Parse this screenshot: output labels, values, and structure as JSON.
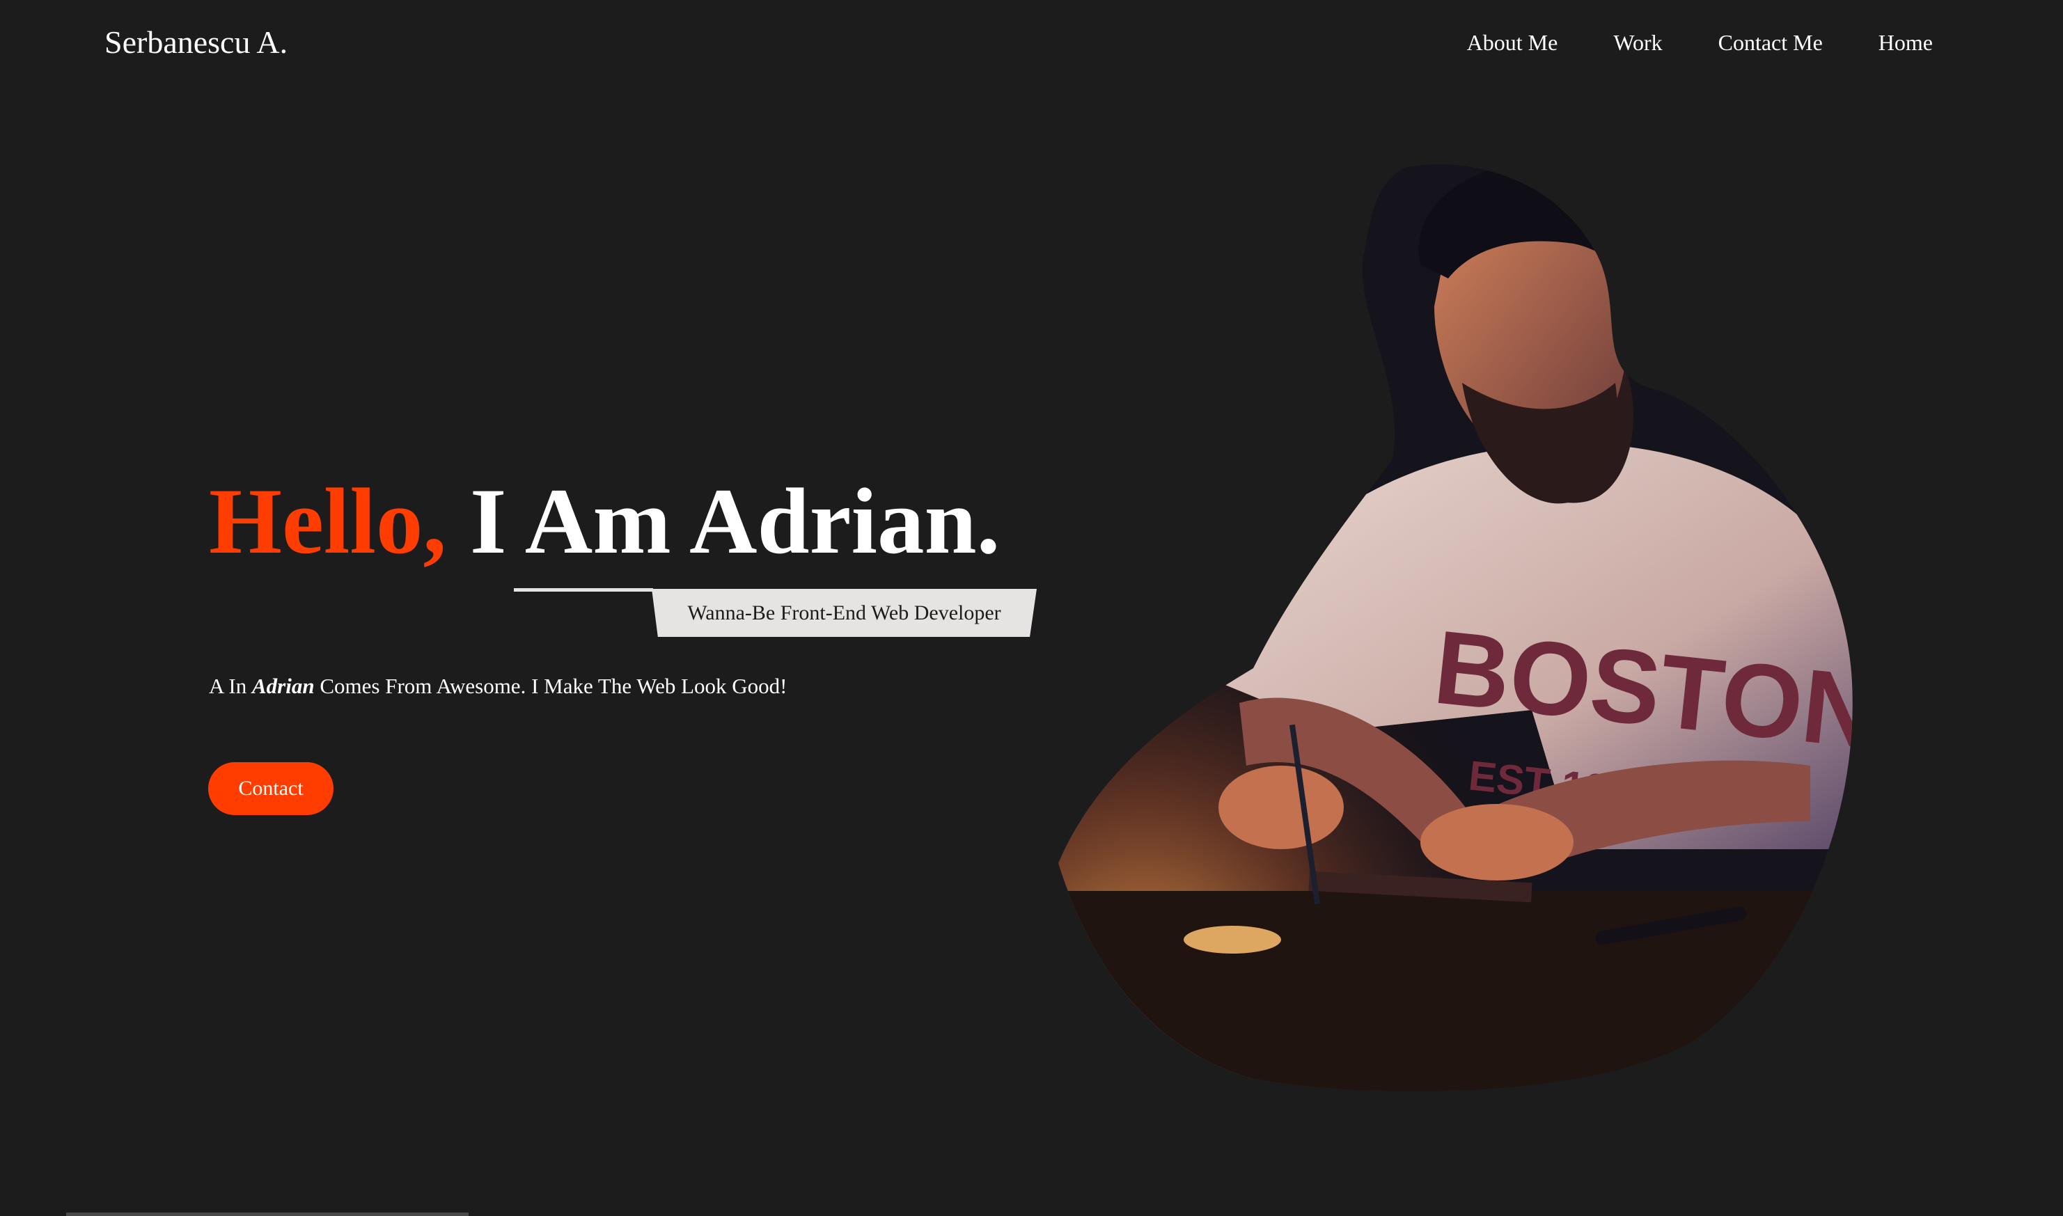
{
  "navbar": {
    "brand": "Serbanescu A.",
    "links": [
      "About Me",
      "Work",
      "Contact Me",
      "Home"
    ]
  },
  "hero": {
    "title_greeting": "Hello,",
    "title_rest": "I Am Adrian.",
    "subtitle": "Wanna-Be Front-End Web Developer",
    "tagline_prefix": "A In",
    "tagline_name": "Adrian",
    "tagline_suffix": "Comes From Awesome. I Make The Web Look Good!",
    "contact_label": "Contact"
  },
  "theme": {
    "background": "#1c1c1c",
    "accent": "#ff3d00",
    "subtitle_bg": "#e6e3e3",
    "text": "#ffffff"
  }
}
